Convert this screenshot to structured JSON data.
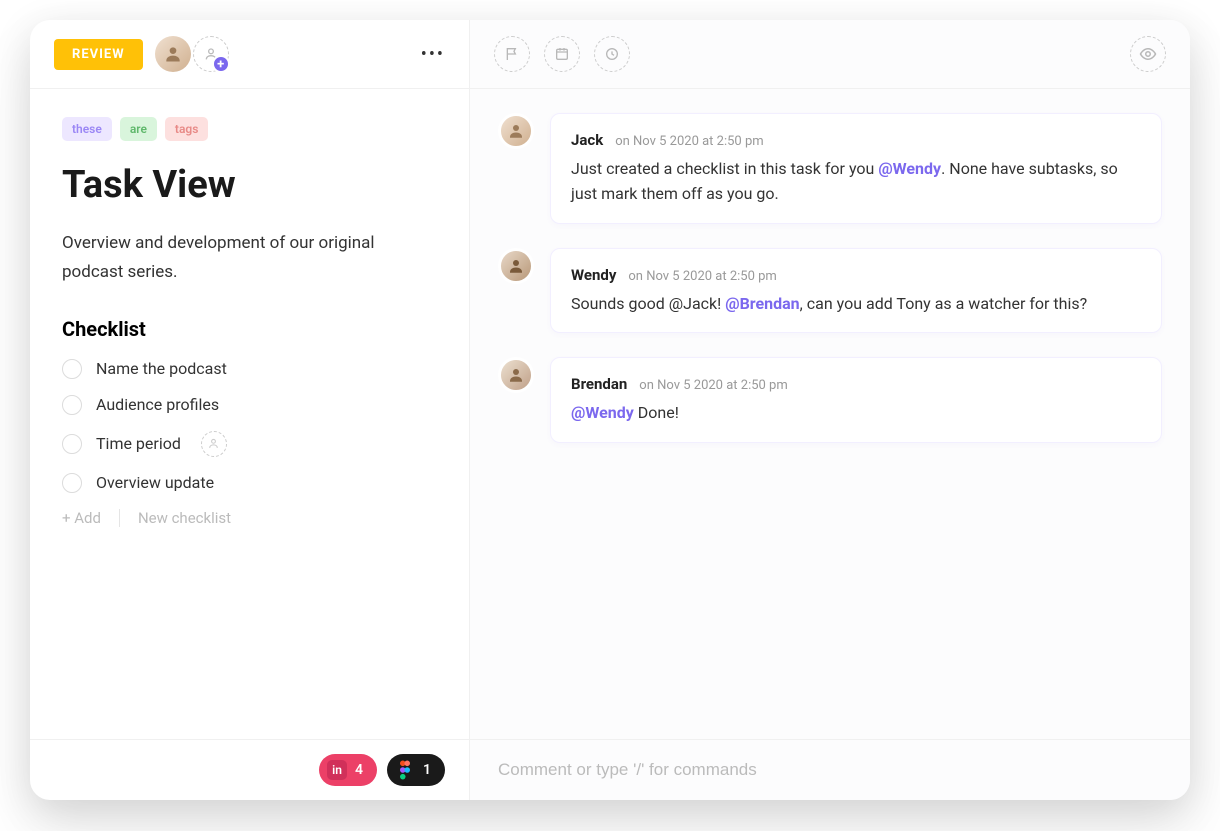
{
  "header": {
    "review_label": "REVIEW"
  },
  "tags": [
    "these",
    "are",
    "tags"
  ],
  "task": {
    "title": "Task View",
    "description": "Overview and development of our original podcast series."
  },
  "checklist": {
    "title": "Checklist",
    "items": [
      {
        "label": "Name the podcast"
      },
      {
        "label": "Audience profiles"
      },
      {
        "label": "Time period"
      },
      {
        "label": "Overview update"
      }
    ],
    "add_label": "+ Add",
    "new_label": "New checklist"
  },
  "footer": {
    "invision_count": "4",
    "figma_count": "1"
  },
  "comments": [
    {
      "author": "Jack",
      "timestamp": "on Nov 5 2020 at 2:50 pm",
      "body_pre": "Just created a checklist in this task for you ",
      "mention": "@Wendy",
      "body_post": ". None have subtasks, so just mark them off as you go."
    },
    {
      "author": "Wendy",
      "timestamp": "on Nov 5 2020 at 2:50 pm",
      "body_pre": "Sounds good @Jack! ",
      "mention": "@Brendan",
      "body_post": ", can you add Tony as a watcher for this?"
    },
    {
      "author": "Brendan",
      "timestamp": "on Nov 5 2020 at 2:50 pm",
      "body_pre": "",
      "mention": "@Wendy",
      "body_post": " Done!"
    }
  ],
  "input": {
    "placeholder": "Comment or type '/' for commands"
  }
}
